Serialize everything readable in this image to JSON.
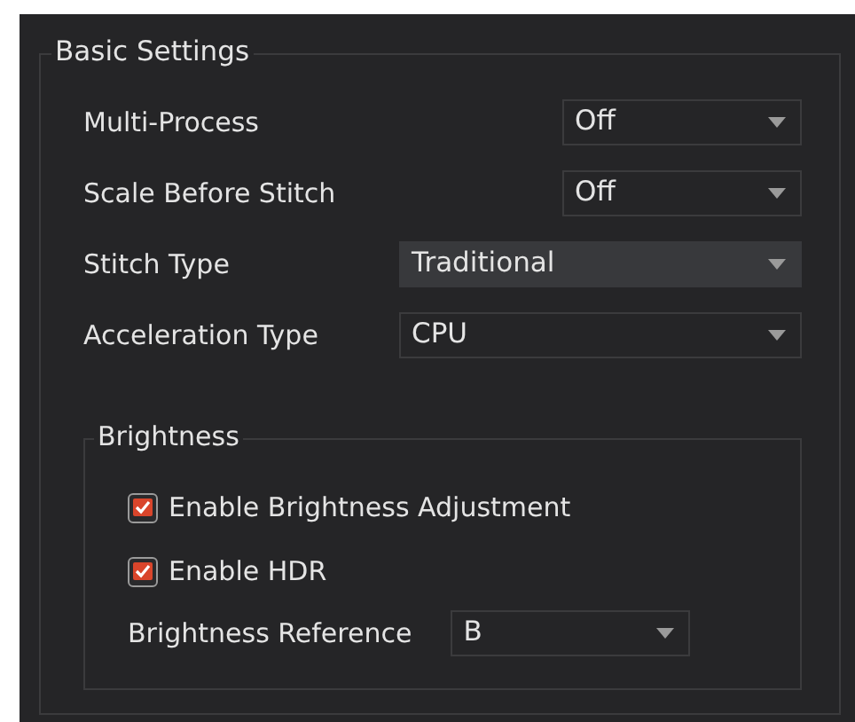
{
  "group": {
    "title": "Basic Settings"
  },
  "settings": [
    {
      "label": "Multi-Process",
      "value": "Off",
      "highlighted": false
    },
    {
      "label": "Scale Before Stitch",
      "value": "Off",
      "highlighted": false
    },
    {
      "label": "Stitch Type",
      "value": "Traditional",
      "highlighted": true
    },
    {
      "label": "Acceleration Type",
      "value": "CPU",
      "highlighted": false
    }
  ],
  "brightness": {
    "title": "Brightness",
    "checkboxes": [
      {
        "label": "Enable Brightness Adjustment",
        "checked": true
      },
      {
        "label": "Enable HDR",
        "checked": true
      }
    ],
    "reference": {
      "label": "Brightness Reference",
      "value": "B",
      "highlighted": false
    }
  }
}
